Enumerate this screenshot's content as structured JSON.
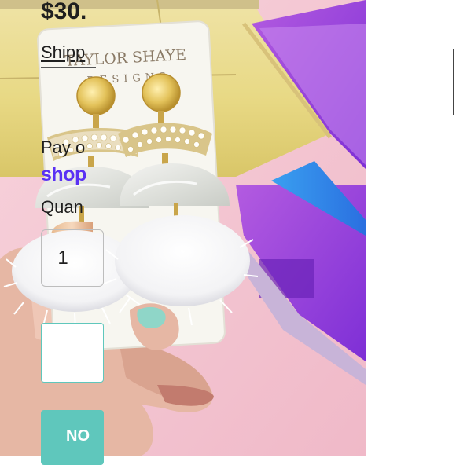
{
  "product_image": {
    "brand_line1": "TAYLOR SHAYE",
    "brand_line2": "DESIGNS"
  },
  "product": {
    "price": "$30.",
    "shipping_label": "Shipp",
    "pay_over_label": "Pay o",
    "shop_pay_label": "shop",
    "quantity_label": "Quan",
    "quantity_value": "1"
  },
  "actions": {
    "buy_now_label": "NO"
  },
  "colors": {
    "accent": "#5fc7bc",
    "shop_pay": "#5a31f4",
    "text": "#1f1f1f"
  }
}
